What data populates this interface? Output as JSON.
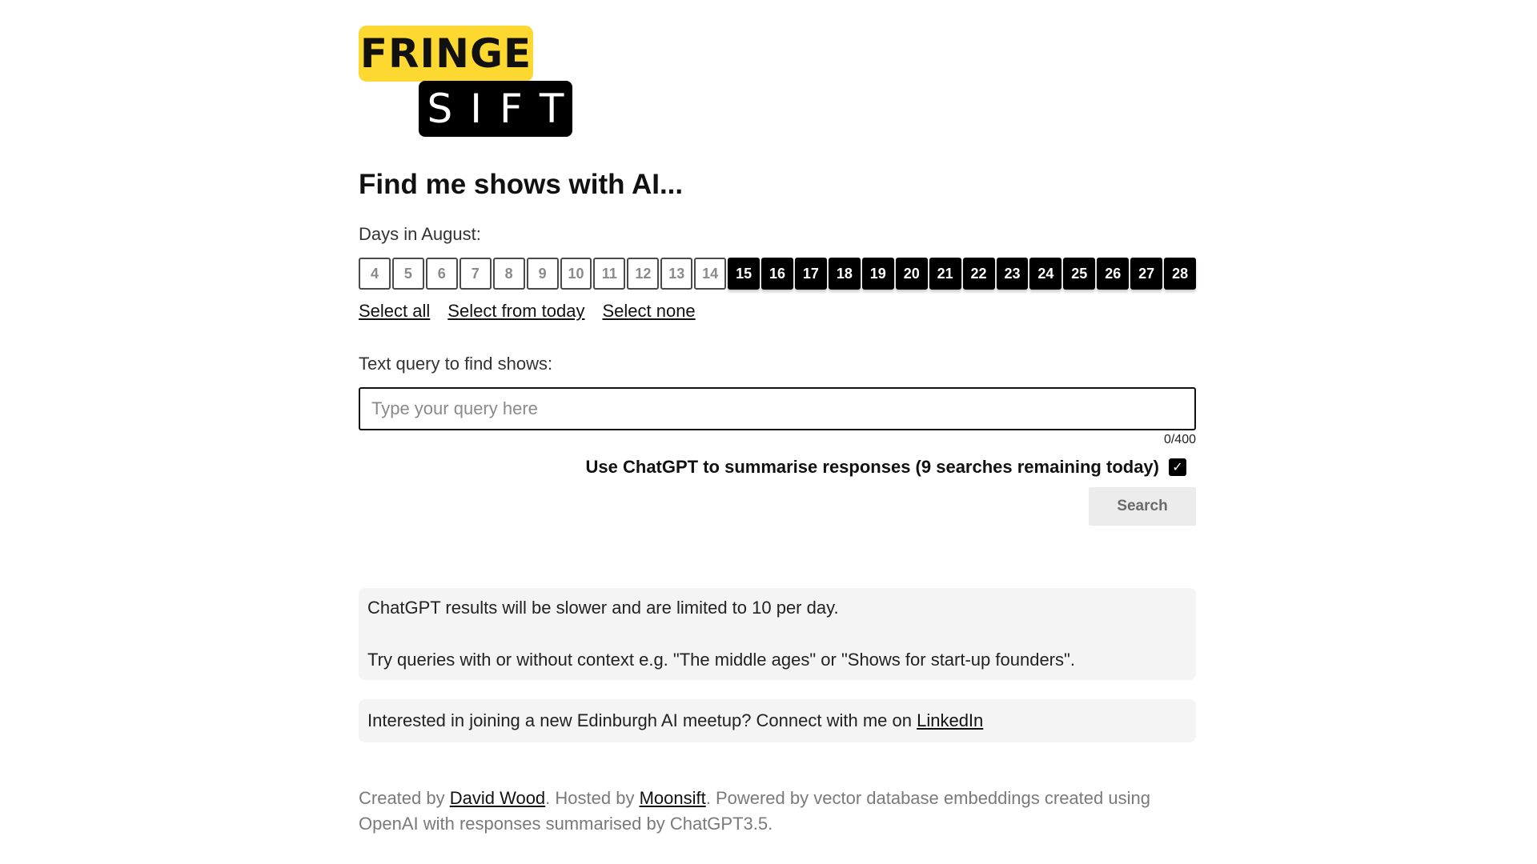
{
  "logo": {
    "top_text": "FRINGE",
    "bottom_text": "SIFT",
    "top_color": "#fcd830",
    "bottom_color": "#000000"
  },
  "heading": "Find me shows with AI...",
  "days": {
    "label": "Days in August:",
    "items": [
      {
        "day": "4",
        "selected": false
      },
      {
        "day": "5",
        "selected": false
      },
      {
        "day": "6",
        "selected": false
      },
      {
        "day": "7",
        "selected": false
      },
      {
        "day": "8",
        "selected": false
      },
      {
        "day": "9",
        "selected": false
      },
      {
        "day": "10",
        "selected": false
      },
      {
        "day": "11",
        "selected": false
      },
      {
        "day": "12",
        "selected": false
      },
      {
        "day": "13",
        "selected": false
      },
      {
        "day": "14",
        "selected": false
      },
      {
        "day": "15",
        "selected": true
      },
      {
        "day": "16",
        "selected": true
      },
      {
        "day": "17",
        "selected": true
      },
      {
        "day": "18",
        "selected": true
      },
      {
        "day": "19",
        "selected": true
      },
      {
        "day": "20",
        "selected": true
      },
      {
        "day": "21",
        "selected": true
      },
      {
        "day": "22",
        "selected": true
      },
      {
        "day": "23",
        "selected": true
      },
      {
        "day": "24",
        "selected": true
      },
      {
        "day": "25",
        "selected": true
      },
      {
        "day": "26",
        "selected": true
      },
      {
        "day": "27",
        "selected": true
      },
      {
        "day": "28",
        "selected": true
      }
    ],
    "select_all": "Select all",
    "select_from_today": "Select from today",
    "select_none": "Select none"
  },
  "query": {
    "label": "Text query to find shows:",
    "value": "",
    "placeholder": "Type your query here",
    "counter": "0/400"
  },
  "chatgpt": {
    "label": "Use ChatGPT to summarise responses (9 searches remaining today)",
    "checked": true
  },
  "search_button": "Search",
  "info": {
    "line1": "ChatGPT results will be slower and are limited to 10 per day.",
    "line2": "Try queries with or without context e.g. \"The middle ages\" or \"Shows for start-up founders\"."
  },
  "meetup": {
    "text": "Interested in joining a new Edinburgh AI meetup? Connect with me on ",
    "link": "LinkedIn"
  },
  "footer": {
    "created_by_prefix": "Created by ",
    "author_link": "David Wood",
    "hosted_by_prefix": ". Hosted by ",
    "host_link": "Moonsift",
    "suffix": ". Powered by vector database embeddings created using OpenAI with responses summarised by ChatGPT3.5."
  }
}
